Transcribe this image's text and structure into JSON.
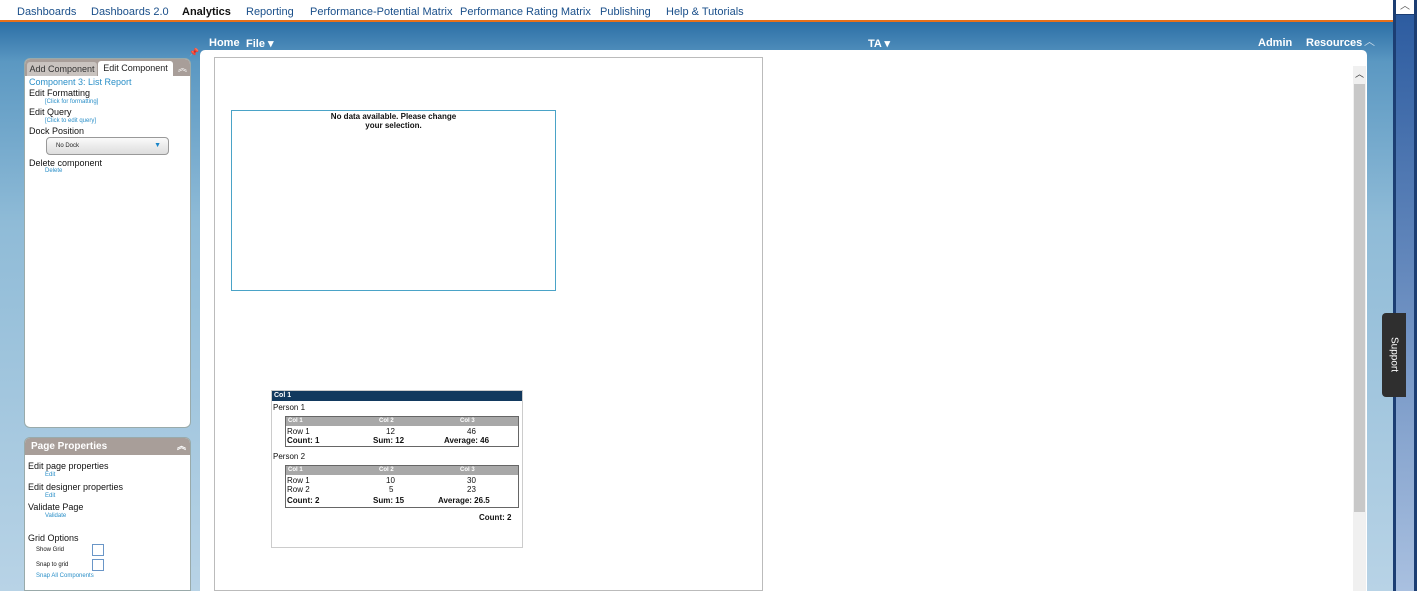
{
  "top_nav": {
    "items": [
      {
        "label": "Dashboards",
        "active": false
      },
      {
        "label": "Dashboards 2.0",
        "active": false
      },
      {
        "label": "Analytics",
        "active": true
      },
      {
        "label": "Reporting",
        "active": false
      },
      {
        "label": "Performance-Potential Matrix",
        "active": false
      },
      {
        "label": "Performance Rating Matrix",
        "active": false
      },
      {
        "label": "Publishing",
        "active": false
      },
      {
        "label": "Help & Tutorials",
        "active": false
      }
    ]
  },
  "toolbar": {
    "home": "Home",
    "file": "File ▾",
    "ta": "TA ▾",
    "admin": "Admin",
    "resources": "Resources",
    "collapse_icon": "chevron-up-icon"
  },
  "component_panel": {
    "tabs": {
      "add": "Add Component",
      "edit": "Edit Component"
    },
    "title": "Component 3: List Report",
    "edit_formatting": {
      "label": "Edit Formatting",
      "link": "[Click for formatting]"
    },
    "edit_query": {
      "label": "Edit Query",
      "link": "[Click to edit query]"
    },
    "dock_position": {
      "label": "Dock Position",
      "value": "No Dock"
    },
    "delete_component": {
      "label": "Delete component",
      "link": "Delete"
    }
  },
  "page_properties": {
    "title": "Page Properties",
    "edit_page": {
      "label": "Edit page properties",
      "link": "Edit"
    },
    "edit_designer": {
      "label": "Edit designer properties",
      "link": "Edit"
    },
    "validate": {
      "label": "Validate Page",
      "link": "Validate"
    },
    "grid_options": {
      "label": "Grid Options",
      "show_grid": "Show Grid",
      "snap_to_grid": "Snap to grid",
      "snap_all": "Snap All Components"
    }
  },
  "no_data_component": {
    "message_line1": "No data available. Please change",
    "message_line2": "your selection."
  },
  "list_report": {
    "header": "Col 1",
    "groups": [
      {
        "person": "Person 1",
        "columns": [
          "Col 1",
          "Col 2",
          "Col 3"
        ],
        "rows": [
          [
            "Row 1",
            "12",
            "46"
          ]
        ],
        "summary": [
          "Count: 1",
          "Sum: 12",
          "Average: 46"
        ]
      },
      {
        "person": "Person 2",
        "columns": [
          "Col 1",
          "Col 2",
          "Col 3"
        ],
        "rows": [
          [
            "Row 1",
            "10",
            "30"
          ],
          [
            "Row 2",
            "5",
            "23"
          ]
        ],
        "summary": [
          "Count: 2",
          "Sum: 15",
          "Average: 26.5"
        ]
      }
    ],
    "grand_count": "Count: 2"
  },
  "support_tab": "Support"
}
